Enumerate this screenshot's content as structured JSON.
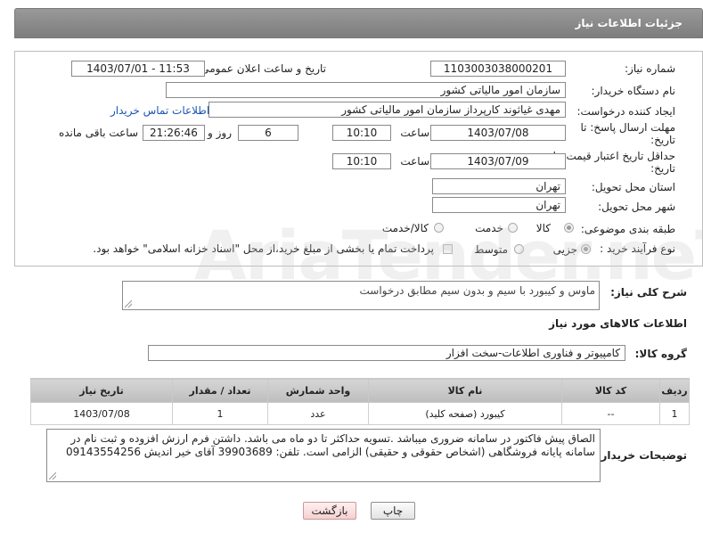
{
  "header": {
    "title": "جزئیات اطلاعات نیاز"
  },
  "fields": {
    "need_number_label": "شماره نیاز:",
    "need_number": "1103003038000201",
    "announce_label": "تاریخ و ساعت اعلان عمومی:",
    "announce_value": "1403/07/01 - 11:53",
    "buyer_org_label": "نام دستگاه خریدار:",
    "buyer_org": "سازمان امور مالیاتی کشور",
    "requester_label": "ایجاد کننده درخواست:",
    "requester": "مهدی غیاثوند کارپرداز سازمان امور مالیاتی کشور",
    "contact_link": "اطلاعات تماس خریدار",
    "deadline_label_1": "مهلت ارسال پاسخ: تا",
    "deadline_label_2": "تاریخ:",
    "deadline_date": "1403/07/08",
    "time_label": "ساعت",
    "deadline_time": "10:10",
    "days_value": "6",
    "days_label": "روز و",
    "remaining_time": "21:26:46",
    "remaining_label": "ساعت باقی مانده",
    "validity_label_1": "حداقل تاریخ اعتبار قیمت: تا",
    "validity_label_2": "تاریخ:",
    "validity_date": "1403/07/09",
    "validity_time_label": "ساعت",
    "validity_time": "10:10",
    "province_label": "استان محل تحویل:",
    "province": "تهران",
    "city_label": "شهر محل تحویل:",
    "city": "تهران",
    "category_label": "طبقه بندی موضوعی:",
    "category_options": [
      "کالا",
      "خدمت",
      "کالا/خدمت"
    ],
    "process_label": "نوع فرآیند خرید :",
    "process_options": [
      "جزیی",
      "متوسط"
    ],
    "payment_note": "پرداخت تمام یا بخشی از مبلغ خرید،از محل \"اسناد خزانه اسلامی\" خواهد بود."
  },
  "description": {
    "label": "شرح کلی نیاز:",
    "value": "ماوس و کیبورد با سیم و بدون سیم مطابق درخواست"
  },
  "goods_section": {
    "title": "اطلاعات کالاهای مورد نیاز",
    "group_label": "گروه کالا:",
    "group_value": "کامپیوتر و فناوری اطلاعات-سخت افزار"
  },
  "table": {
    "columns": [
      "ردیف",
      "کد کالا",
      "نام کالا",
      "واحد شمارش",
      "تعداد / مقدار",
      "تاریخ نیاز"
    ],
    "rows": [
      [
        "1",
        "--",
        "کیبورد (صفحه کلید)",
        "عدد",
        "1",
        "1403/07/08"
      ]
    ]
  },
  "buyer_notes": {
    "label": "توضیحات خریدار:",
    "line1": "الصاق پیش فاکتور در سامانه ضروری میباشد .تسویه حداکثر تا دو ماه می باشد.  داشتن فرم ارزش افزوده و ثبت نام در",
    "line2": "سامانه پایانه فروشگاهی (اشخاص حقوقی و حقیقی) الزامی است. تلفن:  39903689 آقای خیر اندیش 09143554256"
  },
  "buttons": {
    "print": "چاپ",
    "back": "بازگشت"
  },
  "watermark": "AriaTender.neT"
}
